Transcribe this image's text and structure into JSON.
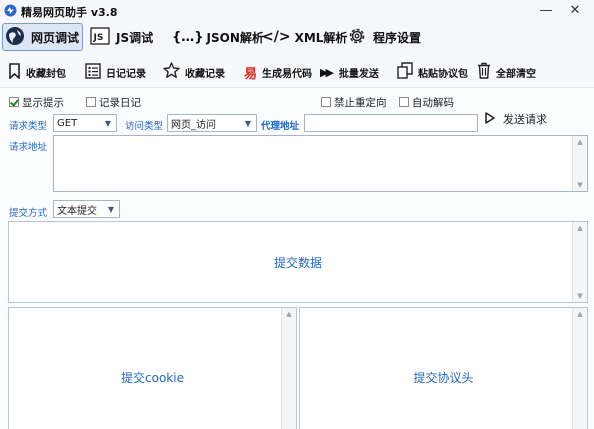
{
  "window": {
    "title": "精易网页助手 v3.8"
  },
  "tabs": [
    {
      "label": "网页调试",
      "icon": "globe-icon"
    },
    {
      "label": "JS调试",
      "icon": "js-icon"
    },
    {
      "label": "JSON解析",
      "icon": "json-braces-icon"
    },
    {
      "label": "XML解析",
      "icon": "code-icon"
    },
    {
      "label": "程序设置",
      "icon": "gear-icon"
    }
  ],
  "toolbar": {
    "collect_packet": "收藏封包",
    "log_records": "日记记录",
    "favorites": "收藏记录",
    "generate_code": "生成易代码",
    "batch_send": "批量发送",
    "paste_packet": "粘贴协议包",
    "clear_all": "全部清空"
  },
  "options": {
    "show_tips": "显示提示",
    "show_tips_checked": true,
    "record_log": "记录日记",
    "record_log_checked": false,
    "disable_redirect": "禁止重定向",
    "disable_redirect_checked": false,
    "auto_decode": "自动解码",
    "auto_decode_checked": false
  },
  "request": {
    "method_label": "请求类型",
    "method_value": "GET",
    "access_label": "访问类型",
    "access_value": "网页_访问",
    "proxy_label": "代理地址",
    "proxy_value": "",
    "send_button": "发送请求",
    "url_label": "请求地址",
    "url_value": "",
    "submit_label": "提交方式",
    "submit_value": "文本提交"
  },
  "panels": {
    "post_data": "提交数据",
    "cookie": "提交cookie",
    "headers": "提交协议头"
  },
  "colors": {
    "label_blue": "#2468c6",
    "generate_code_red": "#e0281e",
    "checkbox_green": "#1e8a1e"
  }
}
